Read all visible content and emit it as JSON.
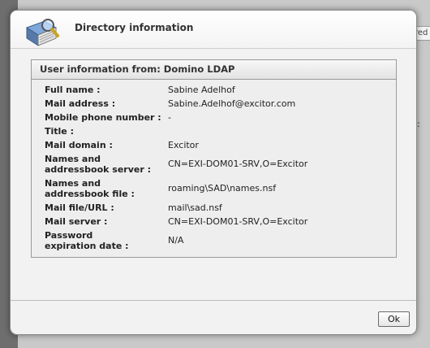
{
  "dialog": {
    "title": "Directory information",
    "icon": "address-book-magnifier-icon",
    "ok_label": "Ok"
  },
  "panel": {
    "heading": "User information from: Domino LDAP",
    "rows": [
      {
        "label": "Full name :",
        "value": "Sabine Adelhof"
      },
      {
        "label": "Mail address :",
        "value": "Sabine.Adelhof@excitor.com"
      },
      {
        "label": "Mobile phone number :",
        "value": "-"
      },
      {
        "label": "Title :",
        "value": ""
      },
      {
        "label": "Mail domain :",
        "value": "Excitor"
      },
      {
        "label": "Names and addressbook server :",
        "value": "CN=EXI-DOM01-SRV,O=Excitor"
      },
      {
        "label": "Names and addressbook file :",
        "value": "roaming\\SAD\\names.nsf"
      },
      {
        "label": "Mail file/URL :",
        "value": "mail\\sad.nsf"
      },
      {
        "label": "Mail server :",
        "value": "CN=EXI-DOM01-SRV,O=Excitor"
      },
      {
        "label": "Password expiration date :",
        "value": "N/A"
      }
    ]
  },
  "background": {
    "field_text": "red",
    "colon_text": ":"
  }
}
